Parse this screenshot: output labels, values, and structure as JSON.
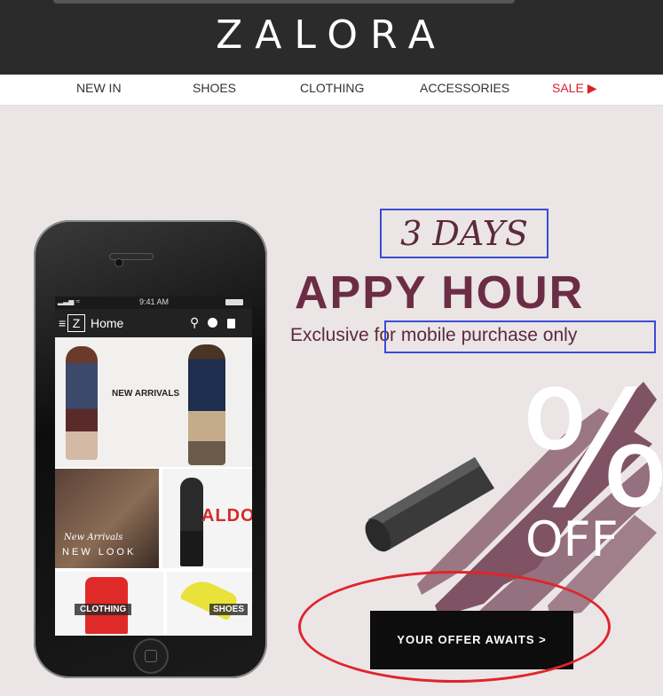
{
  "brand": {
    "logo": "ZALORA"
  },
  "nav": {
    "items": [
      "NEW IN",
      "SHOES",
      "CLOTHING",
      "ACCESSORIES",
      "SALE ▶"
    ]
  },
  "phone": {
    "status_time": "9:41 AM",
    "app_logo": "Z",
    "app_title": "Home",
    "tiles": {
      "new_arrivals": "NEW ARRIVALS",
      "new_look_script": "New Arrivals",
      "new_look": "NEW LOOK",
      "aldo": "ALDO",
      "clothing": "CLOTHING",
      "shoes": "SHOES"
    }
  },
  "promo": {
    "days": "3 DAYS",
    "headline": "APPY HOUR",
    "subtitle_lead": "Exclusive",
    "subtitle_rest": " for mobile purchase only",
    "percent": "%",
    "off": "OFF",
    "cta": "YOUR OFFER AWAITS >"
  },
  "colors": {
    "brand_dark": "#2b2b2b",
    "accent": "#6b2d45",
    "sale": "#d6232e",
    "annotation_blue": "#3d4bd4",
    "annotation_red": "#e0242b"
  }
}
